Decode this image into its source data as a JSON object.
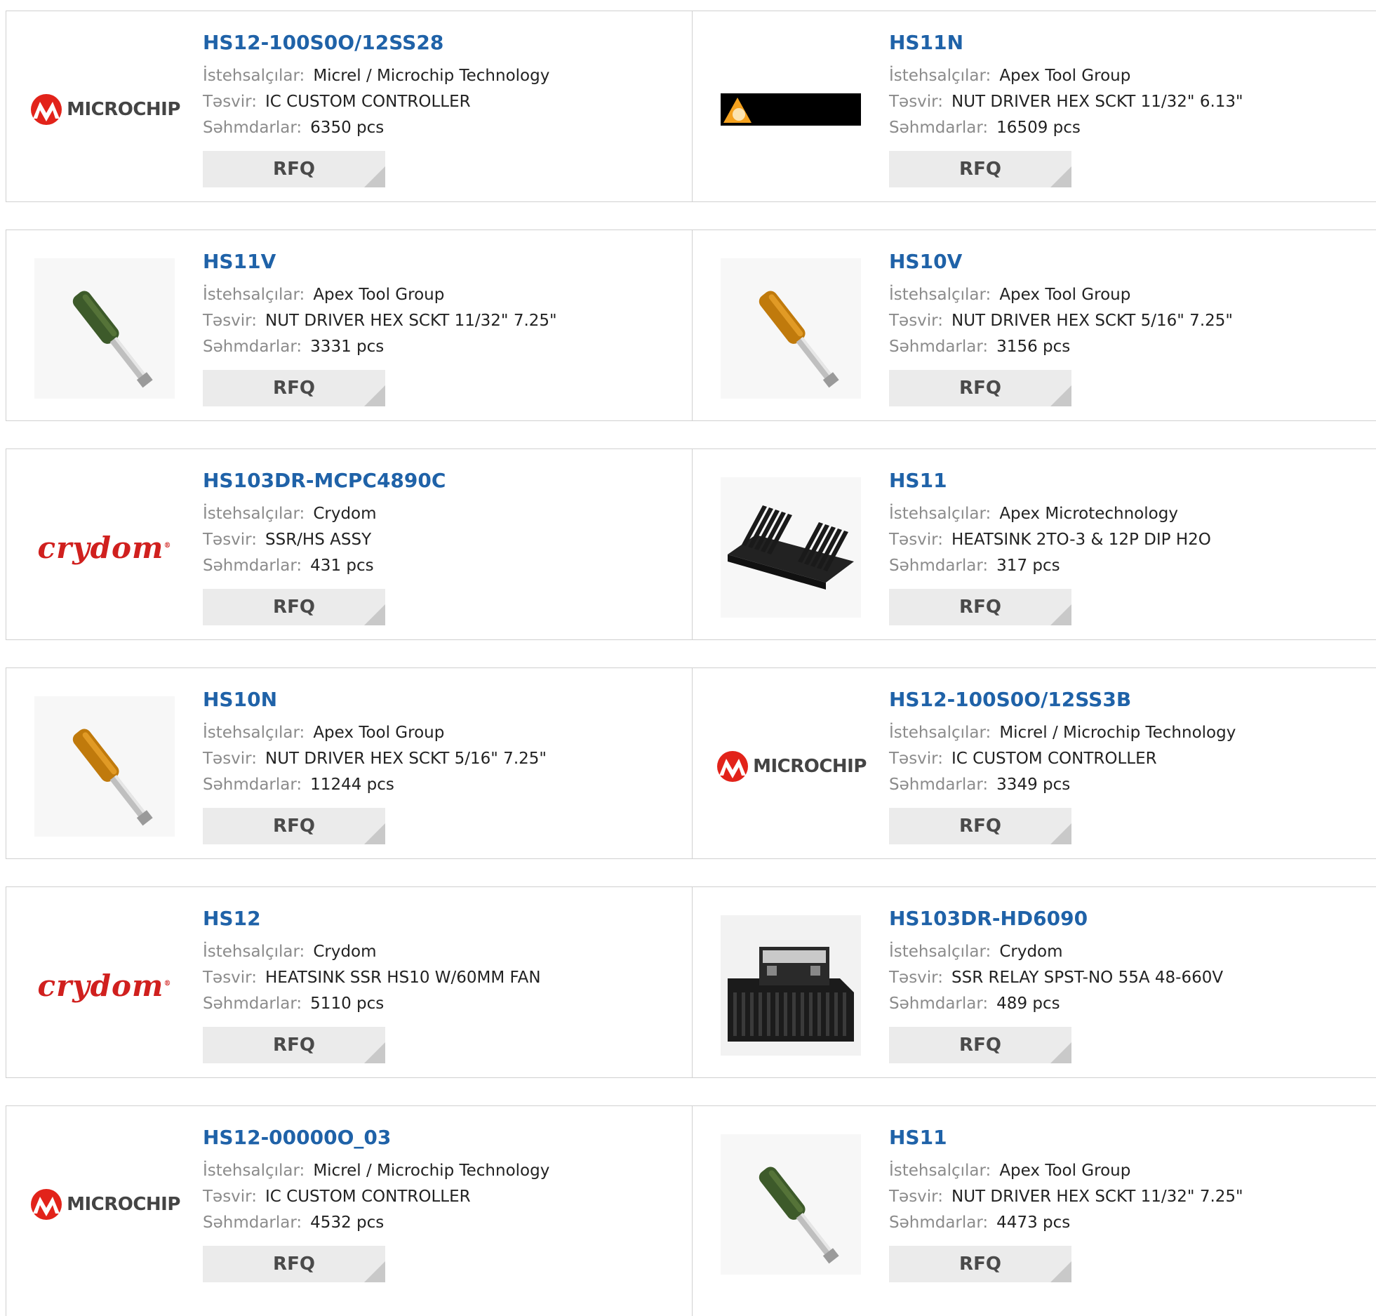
{
  "labels": {
    "manufacturer": "İstehsalçılar:",
    "description": "Təsvir:",
    "stock": "Səhmdarlar:"
  },
  "products": [
    {
      "pn": "HS12-100S0O/12SS28",
      "manufacturer": "Micrel / Microchip Technology",
      "description": "IC CUSTOM CONTROLLER",
      "stock": "6350 pcs",
      "rfq": "RFQ",
      "image": "microchip-logo",
      "logo_text": "MICROCHIP"
    },
    {
      "pn": "HS11N",
      "manufacturer": "Apex Tool Group",
      "description": "NUT DRIVER HEX SCKT 11/32\" 6.13\"",
      "stock": "16509 pcs",
      "rfq": "RFQ",
      "image": "apex-logo-bar"
    },
    {
      "pn": "HS11V",
      "manufacturer": "Apex Tool Group",
      "description": "NUT DRIVER HEX SCKT 11/32\" 7.25\"",
      "stock": "3331 pcs",
      "rfq": "RFQ",
      "image": "green-nut-driver"
    },
    {
      "pn": "HS10V",
      "manufacturer": "Apex Tool Group",
      "description": "NUT DRIVER HEX SCKT 5/16\" 7.25\"",
      "stock": "3156 pcs",
      "rfq": "RFQ",
      "image": "amber-nut-driver"
    },
    {
      "pn": "HS103DR-MCPC4890C",
      "manufacturer": "Crydom",
      "description": "SSR/HS ASSY",
      "stock": "431 pcs",
      "rfq": "RFQ",
      "image": "crydom-logo",
      "logo_text": "crydom"
    },
    {
      "pn": "HS11",
      "manufacturer": "Apex Microtechnology",
      "description": "HEATSINK 2TO-3 & 12P DIP H2O",
      "stock": "317 pcs",
      "rfq": "RFQ",
      "image": "heatsink"
    },
    {
      "pn": "HS10N",
      "manufacturer": "Apex Tool Group",
      "description": "NUT DRIVER HEX SCKT 5/16\" 7.25\"",
      "stock": "11244 pcs",
      "rfq": "RFQ",
      "image": "amber-nut-driver"
    },
    {
      "pn": "HS12-100S0O/12SS3B",
      "manufacturer": "Micrel / Microchip Technology",
      "description": "IC CUSTOM CONTROLLER",
      "stock": "3349 pcs",
      "rfq": "RFQ",
      "image": "microchip-logo",
      "logo_text": "MICROCHIP"
    },
    {
      "pn": "HS12",
      "manufacturer": "Crydom",
      "description": "HEATSINK SSR HS10 W/60MM FAN",
      "stock": "5110 pcs",
      "rfq": "RFQ",
      "image": "crydom-logo",
      "logo_text": "crydom"
    },
    {
      "pn": "HS103DR-HD6090",
      "manufacturer": "Crydom",
      "description": "SSR RELAY SPST-NO 55A 48-660V",
      "stock": "489 pcs",
      "rfq": "RFQ",
      "image": "ssr-heatsink"
    },
    {
      "pn": "HS12-00000O_03",
      "manufacturer": "Micrel / Microchip Technology",
      "description": "IC CUSTOM CONTROLLER",
      "stock": "4532 pcs",
      "rfq": "RFQ",
      "image": "microchip-logo",
      "logo_text": "MICROCHIP"
    },
    {
      "pn": "HS11",
      "manufacturer": "Apex Tool Group",
      "description": "NUT DRIVER HEX SCKT 11/32\" 7.25\"",
      "stock": "4473 pcs",
      "rfq": "RFQ",
      "image": "green-nut-driver"
    }
  ]
}
